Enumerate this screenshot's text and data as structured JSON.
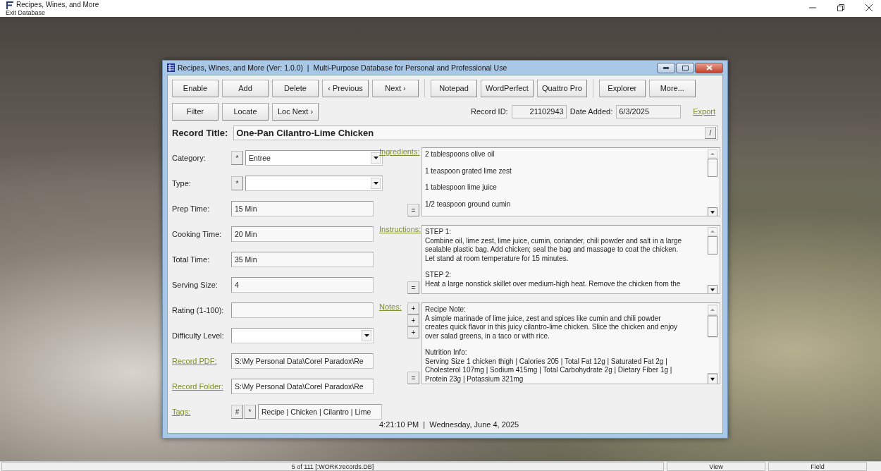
{
  "app_window": {
    "title": "Recipes, Wines, and More",
    "menu": [
      "Exit Database"
    ]
  },
  "form_window": {
    "title": "Recipes, Wines, and More (Ver: 1.0.0)  |  Multi-Purpose Database for Personal and Professional Use"
  },
  "toolbar_rows": [
    [
      {
        "label": "Enable"
      },
      {
        "label": "Add"
      },
      {
        "label": "Delete"
      },
      {
        "label": "‹ Previous"
      },
      {
        "label": "Next ›"
      },
      {
        "kind": "separator"
      },
      {
        "label": "Notepad"
      },
      {
        "label": "WordPerfect"
      },
      {
        "label": "Quattro Pro"
      },
      {
        "kind": "separator"
      },
      {
        "label": "Explorer"
      },
      {
        "label": "More..."
      }
    ],
    [
      {
        "label": "Filter"
      },
      {
        "label": "Locate"
      },
      {
        "label": "Loc Next ›"
      }
    ]
  ],
  "record_id": {
    "label": "Record ID:",
    "value": "21102943"
  },
  "date_added": {
    "label": "Date Added:",
    "value": "6/3/2025"
  },
  "export_link": "Export",
  "record_title": {
    "label": "Record Title:",
    "value": "One-Pan Cilantro-Lime Chicken",
    "button": "/"
  },
  "fields": [
    {
      "kind": "dropdown",
      "label": "Category:",
      "buttons": [
        "*"
      ],
      "value": "Entree"
    },
    {
      "kind": "dropdown",
      "label": "Type:",
      "buttons": [
        "*"
      ]
    },
    {
      "kind": "text",
      "label": "Prep Time:",
      "value": "15 Min"
    },
    {
      "kind": "text",
      "label": "Cooking Time:",
      "value": "20 Min"
    },
    {
      "kind": "text",
      "label": "Total Time:",
      "value": "35 Min"
    },
    {
      "kind": "text",
      "label": "Serving Size:",
      "value": "4"
    },
    {
      "kind": "text",
      "label": "Rating (1-100):"
    },
    {
      "kind": "dropdown",
      "label": "Difficulty Level:"
    },
    {
      "kind": "link",
      "label": "Record PDF:",
      "value": "S:\\My Personal Data\\Corel Paradox\\Re"
    },
    {
      "kind": "link",
      "label": "Record Folder:",
      "value": "S:\\My Personal Data\\Corel Paradox\\Re"
    },
    {
      "kind": "link",
      "label": "Tags:",
      "buttons": [
        "#",
        "*"
      ],
      "value": "Recipe | Chicken | Cilantro | Lime"
    }
  ],
  "memos": [
    {
      "label": "Ingredients:",
      "bottom_button": "=",
      "paragraphs": [
        [
          "2 tablespoons olive oil"
        ],
        [
          "1 teaspoon grated lime zest"
        ],
        [
          "1 tablespoon lime juice"
        ],
        [
          "1/2 teaspoon ground cumin"
        ]
      ]
    },
    {
      "label": "Instructions:",
      "bottom_button": "=",
      "paragraphs": [
        [
          "STEP 1:",
          "Combine oil, lime zest, lime juice, cumin, coriander, chili powder and salt in a large",
          "sealable plastic bag. Add chicken; seal the bag and massage to coat the chicken.",
          "Let stand at room temperature for 15 minutes."
        ],
        [
          "STEP 2:",
          "Heat a large nonstick skillet over medium-high heat. Remove the chicken from the"
        ]
      ]
    },
    {
      "label": "Notes:",
      "top_buttons": [
        "+",
        "+",
        "+"
      ],
      "bottom_button": "=",
      "paragraphs": [
        [
          "Recipe Note:",
          "A simple marinade of lime juice, zest and spices like cumin and chili powder",
          "creates quick flavor in this juicy cilantro-lime chicken. Slice the chicken and enjoy",
          "over salad greens, in a taco or with rice."
        ],
        [
          "Nutrition Info:",
          "Serving Size 1 chicken thigh | Calories 205 | Total Fat 12g | Saturated Fat 2g |",
          "Cholesterol 107mg | Sodium 415mg | Total Carbohydrate 2g | Dietary Fiber 1g |",
          "Protein 23g | Potassium 321mg"
        ]
      ]
    }
  ],
  "clock": "4:21:10 PM  |  Wednesday, June 4, 2025",
  "status_bar": [
    "5 of 111 [:WORK:records.DB]",
    "View",
    "Field"
  ]
}
